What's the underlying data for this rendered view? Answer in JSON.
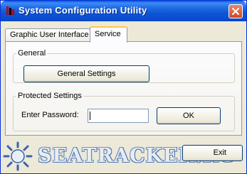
{
  "window": {
    "title": "System Configuration Utility",
    "accent_color": "#0a5ade"
  },
  "tabs": [
    {
      "label": "Graphic User Interface",
      "active": false
    },
    {
      "label": "Service",
      "active": true
    }
  ],
  "general": {
    "legend": "General",
    "settings_button": "General Settings"
  },
  "protected": {
    "legend": "Protected Settings",
    "password_label": "Enter Password:",
    "password_value": "",
    "ok_button": "OK"
  },
  "footer": {
    "exit_button": "Exit"
  },
  "watermark": {
    "text": "SEATRACKER.RU"
  }
}
